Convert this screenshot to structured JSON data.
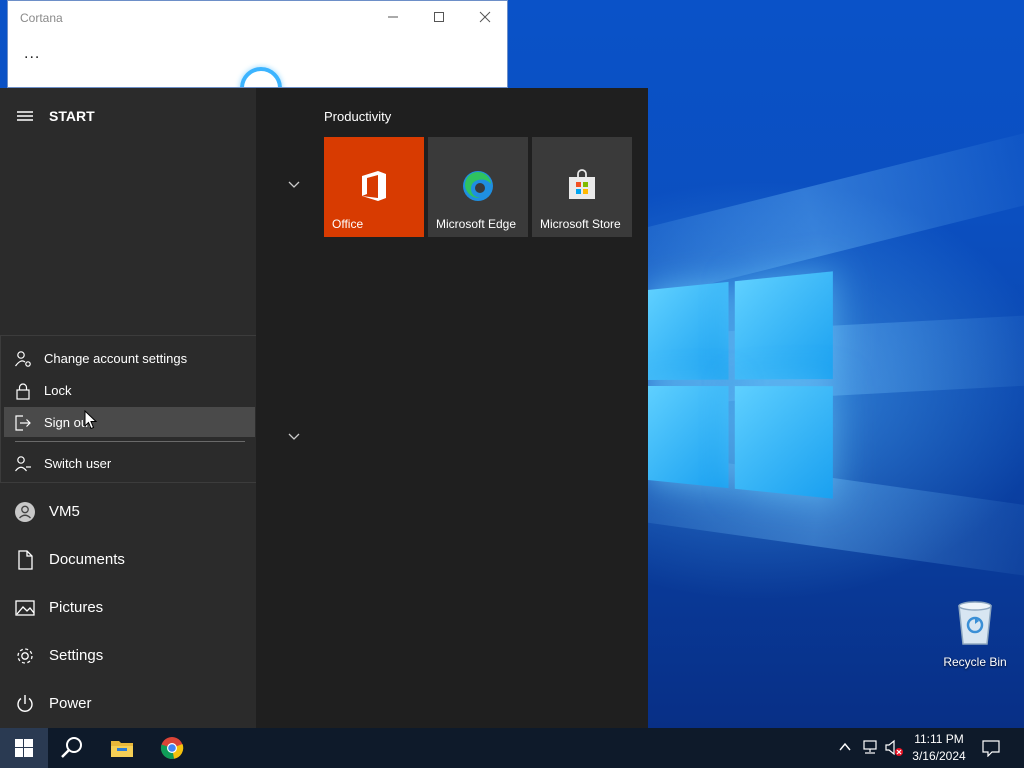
{
  "colors": {
    "office_tile": "#d83b01",
    "tile_bg": "#3a3a3a",
    "start_left_bg": "#2b2b2b",
    "start_right_bg": "#1f1f1f",
    "taskbar_bg": "#0e1a2a"
  },
  "cortana": {
    "title": "Cortana",
    "more_label": "..."
  },
  "start": {
    "header": "START",
    "account_flyout": {
      "items": [
        {
          "label": "Change account settings",
          "icon": "account-settings-icon"
        },
        {
          "label": "Lock",
          "icon": "lock-icon"
        },
        {
          "label": "Sign out",
          "icon": "sign-out-icon"
        },
        {
          "label": "Switch user",
          "icon": "switch-user-icon"
        }
      ]
    },
    "nav": [
      {
        "label": "VM5",
        "icon": "avatar-icon"
      },
      {
        "label": "Documents",
        "icon": "document-icon"
      },
      {
        "label": "Pictures",
        "icon": "pictures-icon"
      },
      {
        "label": "Settings",
        "icon": "gear-icon"
      },
      {
        "label": "Power",
        "icon": "power-icon"
      }
    ],
    "group_title": "Productivity",
    "tiles": [
      {
        "label": "Office",
        "icon": "office-icon"
      },
      {
        "label": "Microsoft Edge",
        "icon": "edge-icon"
      },
      {
        "label": "Microsoft Store",
        "icon": "store-icon"
      }
    ]
  },
  "desktop": {
    "recycle_bin_label": "Recycle Bin"
  },
  "taskbar": {
    "time": "11:11 PM",
    "date": "3/16/2024"
  }
}
